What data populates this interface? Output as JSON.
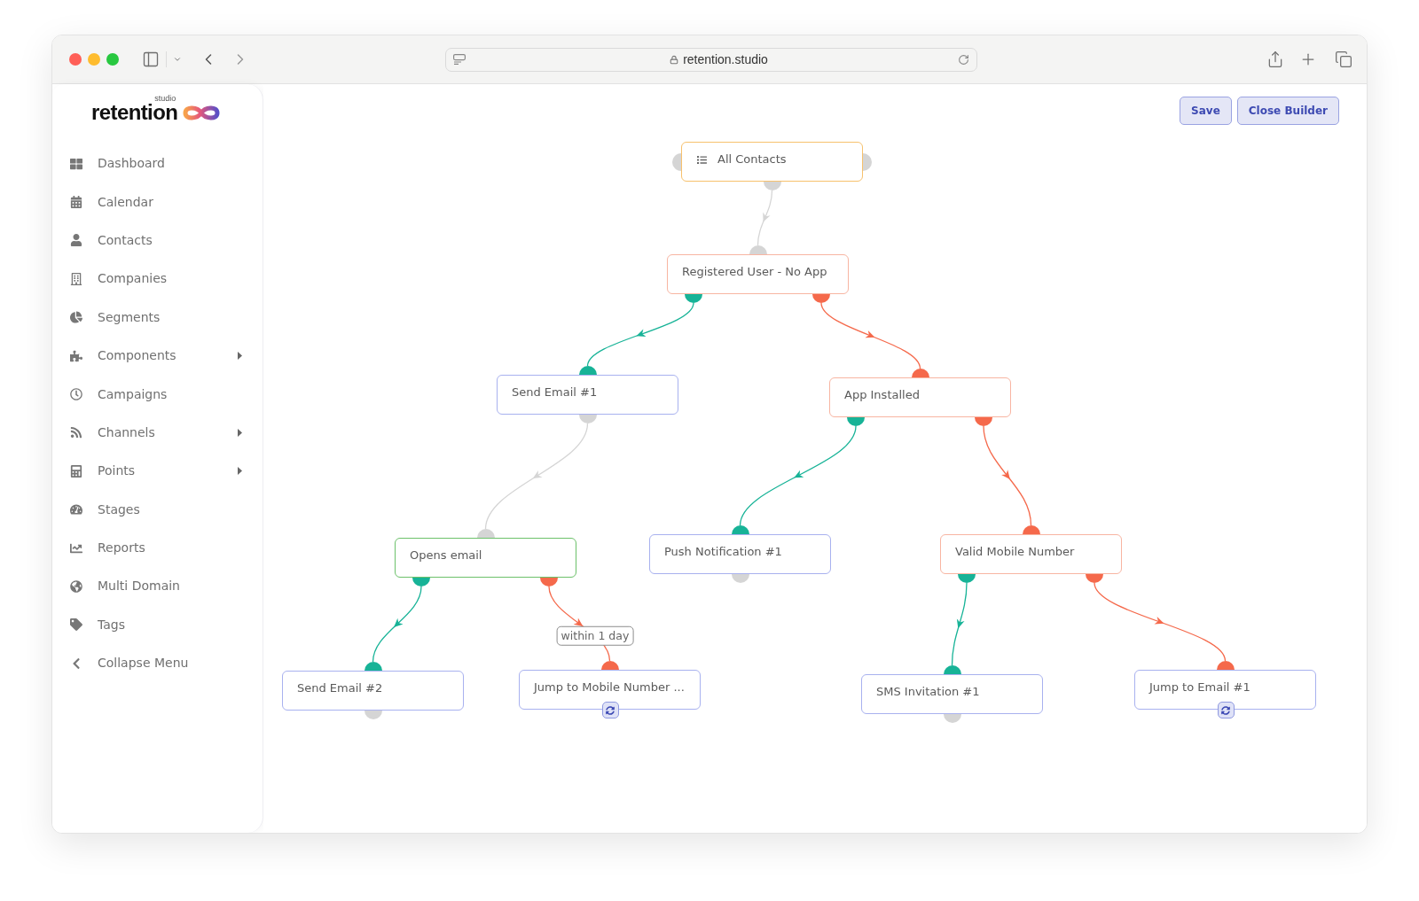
{
  "browser": {
    "url": "retention.studio"
  },
  "sidebar": {
    "logo": {
      "wordmark": "retention",
      "tagline": "studio"
    },
    "items": [
      {
        "label": "Dashboard",
        "has_submenu": false
      },
      {
        "label": "Calendar",
        "has_submenu": false
      },
      {
        "label": "Contacts",
        "has_submenu": false
      },
      {
        "label": "Companies",
        "has_submenu": false
      },
      {
        "label": "Segments",
        "has_submenu": false
      },
      {
        "label": "Components",
        "has_submenu": true
      },
      {
        "label": "Campaigns",
        "has_submenu": false
      },
      {
        "label": "Channels",
        "has_submenu": true
      },
      {
        "label": "Points",
        "has_submenu": true
      },
      {
        "label": "Stages",
        "has_submenu": false
      },
      {
        "label": "Reports",
        "has_submenu": false
      },
      {
        "label": "Multi Domain",
        "has_submenu": false
      },
      {
        "label": "Tags",
        "has_submenu": false
      },
      {
        "label": "Collapse Menu",
        "has_submenu": false
      }
    ]
  },
  "toolbar": {
    "buttons": [
      {
        "label": "Save"
      },
      {
        "label": "Close Builder"
      }
    ]
  },
  "flow": {
    "root": {
      "label": "All Contacts",
      "kind": "source",
      "children": [
        {
          "label": "Registered User - No App",
          "kind": "condition",
          "edge": {
            "kind": "next"
          },
          "children": [
            {
              "label": "Send Email #1",
              "kind": "action",
              "edge": {
                "kind": "yes"
              },
              "children": [
                {
                  "label": "Opens email",
                  "kind": "decision",
                  "edge": {
                    "kind": "next"
                  },
                  "children": [
                    {
                      "label": "Send Email #2",
                      "kind": "action",
                      "edge": {
                        "kind": "yes"
                      }
                    },
                    {
                      "label": "Jump to Mobile Number ...",
                      "kind": "jump",
                      "edge": {
                        "kind": "no",
                        "label": "within 1 day"
                      }
                    }
                  ]
                }
              ]
            },
            {
              "label": "App Installed",
              "kind": "condition",
              "edge": {
                "kind": "no"
              },
              "children": [
                {
                  "label": "Push Notification #1",
                  "kind": "action",
                  "edge": {
                    "kind": "yes"
                  }
                },
                {
                  "label": "Valid Mobile Number",
                  "kind": "condition",
                  "edge": {
                    "kind": "no"
                  },
                  "children": [
                    {
                      "label": "SMS Invitation #1",
                      "kind": "action",
                      "edge": {
                        "kind": "yes"
                      }
                    },
                    {
                      "label": "Jump to Email #1",
                      "kind": "jump",
                      "edge": {
                        "kind": "no"
                      }
                    }
                  ]
                }
              ]
            }
          ]
        }
      ]
    }
  }
}
